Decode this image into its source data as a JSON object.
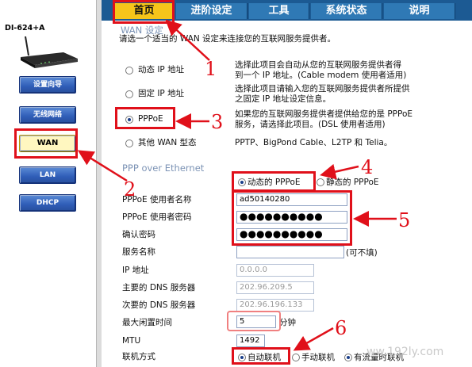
{
  "sidebar": {
    "device_model": "DI-624+A",
    "buttons": [
      "设置向导",
      "无线网络",
      "WAN",
      "LAN",
      "DHCP"
    ]
  },
  "tabs": [
    "首页",
    "进阶设定",
    "工具",
    "系统状态",
    "说明"
  ],
  "wan": {
    "title": "WAN 设定",
    "subtitle": "请选一个适当的 WAN 设定来连接您的互联网服务提供者。",
    "options": [
      {
        "label": "动态 IP 地址",
        "desc1": "选择此项目会自动从您的互联网服务提供者得",
        "desc2": "到一个 IP 地址。(Cable modem 使用者适用)",
        "selected": false
      },
      {
        "label": "固定 IP 地址",
        "desc1": "选择此项目请输入您的互联网服务提供者所提供",
        "desc2": "之固定 IP 地址设定信息。",
        "selected": false
      },
      {
        "label": "PPPoE",
        "desc1": "如果您的互联网服务提供者提供给您的是 PPPoE",
        "desc2": "服务，请选择此项目。(DSL 使用者适用)",
        "selected": true
      },
      {
        "label": "其他 WAN 型态",
        "desc1": "PPTP、BigPond Cable、L2TP 和 Telia。",
        "desc2": "",
        "selected": false
      }
    ]
  },
  "pppoe": {
    "title": "PPP over Ethernet",
    "mode_dynamic": "动态的 PPPoE",
    "mode_static": "静态的 PPPoE",
    "mode_selected": "dynamic",
    "fields": {
      "username_label": "PPPoE 使用者名称",
      "username_value": "ad50140280",
      "password_label": "PPPoE 使用者密码",
      "password_value": "●●●●●●●●●●",
      "confirm_label": "确认密码",
      "confirm_value": "●●●●●●●●●●",
      "service_label": "服务名称",
      "service_value": "",
      "service_note": "(可不填)",
      "ip_label": "IP 地址",
      "ip_value": "0.0.0.0",
      "dns1_label": "主要的 DNS 服务器",
      "dns1_value": "202.96.209.5",
      "dns2_label": "次要的 DNS 服务器",
      "dns2_value": "202.96.196.133",
      "idle_label": "最大闲置时间",
      "idle_value": "5",
      "idle_unit": "分钟",
      "mtu_label": "MTU",
      "mtu_value": "1492",
      "connect_label": "联机方式",
      "connect_options": [
        "自动联机",
        "手动联机",
        "有流量时联机"
      ],
      "connect_selected": "自动联机"
    }
  },
  "annotations": [
    "1",
    "2",
    "3",
    "4",
    "5",
    "6"
  ],
  "watermark": "ww.192ly.com",
  "colors": {
    "annotation": "#e0101a",
    "tab_active": "#f6c51a",
    "tab": "#2f79b5",
    "sidebar_button": "#2f5db7"
  }
}
